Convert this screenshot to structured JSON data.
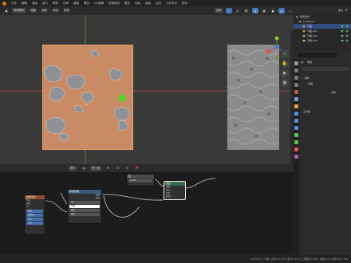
{
  "menubar": {
    "items": [
      "文件",
      "编辑",
      "渲染",
      "窗口",
      "帮助",
      "布局",
      "建模",
      "雕刻",
      "UV编辑",
      "纹理绘制",
      "着色",
      "动画",
      "渲染",
      "合成",
      "几何节点",
      "脚本"
    ]
  },
  "viewport": {
    "mode_label": "物体模式",
    "menus": [
      "视图",
      "选择",
      "添加",
      "物体"
    ],
    "transform_label": "全局"
  },
  "node_editor": {
    "object_label": "物体",
    "slot_label": "槽 1",
    "material_name": "青土地",
    "value_node": {
      "title": "值",
      "value": "0.200"
    },
    "texcoord_node": {
      "title": "纹理坐标",
      "outputs": [
        "生成",
        "法向",
        "UV",
        "物体",
        "摄像机",
        "窗口",
        "反射"
      ]
    },
    "noise_node": {
      "title": "噪波纹理",
      "outputs": [
        "系数",
        "颜色"
      ],
      "fields": [
        "3D",
        "矢量",
        "缩放",
        "细节",
        "粗糙度",
        "畸变"
      ]
    },
    "mix_node": {
      "title": "混合",
      "rows": [
        "结果",
        "混合",
        "系数",
        "颜色1",
        "颜色2"
      ]
    }
  },
  "outliner": {
    "header_label": "选项",
    "rows": [
      {
        "label": "场景集合",
        "indent": 0,
        "selected": false,
        "icon": "collection-icon"
      },
      {
        "label": "Collection",
        "indent": 1,
        "selected": false,
        "icon": "collection-icon"
      },
      {
        "label": "平面",
        "indent": 2,
        "selected": true,
        "icon": "mesh-icon"
      },
      {
        "label": "平面.001",
        "indent": 2,
        "selected": false,
        "icon": "mesh-icon"
      },
      {
        "label": "平面.002",
        "indent": 2,
        "selected": false,
        "icon": "mesh-icon"
      },
      {
        "label": "平面.003",
        "indent": 2,
        "selected": false,
        "icon": "mesh-icon"
      }
    ]
  },
  "properties": {
    "search_placeholder": "",
    "panel_label": "笔刷",
    "section_options": "选项",
    "subsection_transform": "变换",
    "value_label": "切换",
    "section_workspace": "工作区"
  },
  "status": {
    "text": "Collection | 平面 | 顶点:32,643 | 面:31,974 | 三角面:63,952 | 物体:1/4 | 内存:56.0 GiB"
  },
  "colors": {
    "accent_blue": "#4772b3",
    "plane_orange": "#c98a66",
    "selection_outline": "#e8a16e",
    "axis_red": "#b84b4b",
    "axis_green": "#6a9a3a"
  }
}
